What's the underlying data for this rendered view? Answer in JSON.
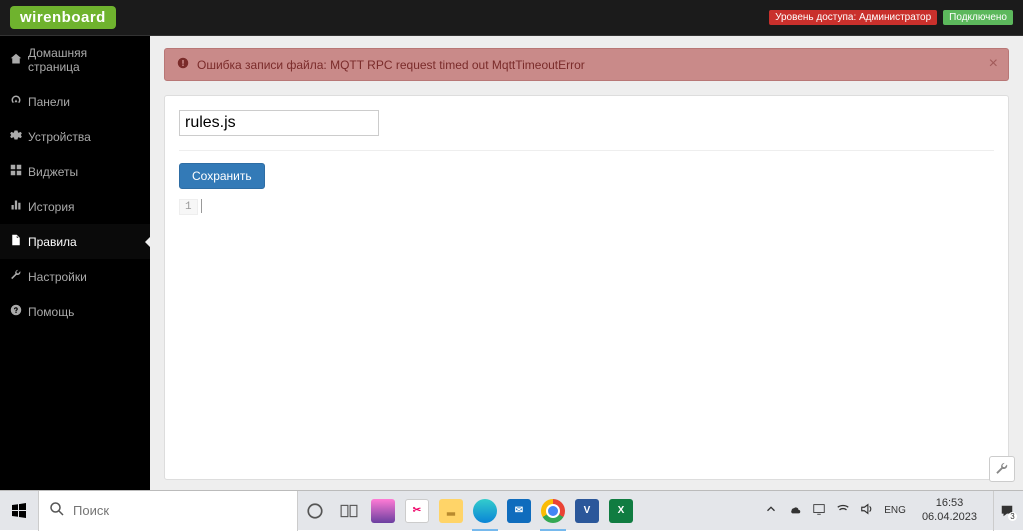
{
  "header": {
    "logo": "wirenboard",
    "access_level": "Уровень доступа: Администратор",
    "connection": "Подключено"
  },
  "sidebar": {
    "items": [
      {
        "label": "Домашняя страница",
        "icon": "home"
      },
      {
        "label": "Панели",
        "icon": "dashboard"
      },
      {
        "label": "Устройства",
        "icon": "gear"
      },
      {
        "label": "Виджеты",
        "icon": "grid"
      },
      {
        "label": "История",
        "icon": "bars"
      },
      {
        "label": "Правила",
        "icon": "file",
        "active": true
      },
      {
        "label": "Настройки",
        "icon": "wrench"
      },
      {
        "label": "Помощь",
        "icon": "help"
      }
    ]
  },
  "alert": {
    "text": "Ошибка записи файла: MQTT RPC request timed out MqttTimeoutError"
  },
  "editor": {
    "filename": "rules.js",
    "save_button": "Сохранить",
    "line_number": "1",
    "content": ""
  },
  "taskbar": {
    "search_placeholder": "Поиск",
    "language": "ENG",
    "time": "16:53",
    "date": "06.04.2023",
    "notification_count": "3"
  }
}
